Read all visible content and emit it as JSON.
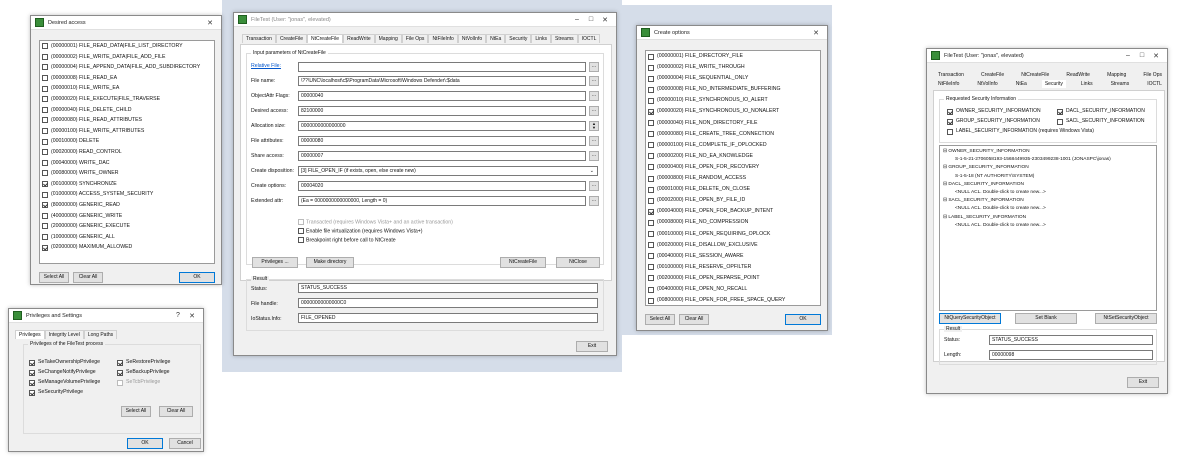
{
  "desired_access": {
    "title": "Desired access",
    "items": [
      {
        "label": "(00000001) FILE_READ_DATA|FILE_LIST_DIRECTORY",
        "checked": false
      },
      {
        "label": "(00000002) FILE_WRITE_DATA|FILE_ADD_FILE",
        "checked": false
      },
      {
        "label": "(00000004) FILE_APPEND_DATA|FILE_ADD_SUBDIRECTORY",
        "checked": false
      },
      {
        "label": "(00000008) FILE_READ_EA",
        "checked": false
      },
      {
        "label": "(00000010) FILE_WRITE_EA",
        "checked": false
      },
      {
        "label": "(00000020) FILE_EXECUTE|FILE_TRAVERSE",
        "checked": false
      },
      {
        "label": "(00000040) FILE_DELETE_CHILD",
        "checked": false
      },
      {
        "label": "(00000080) FILE_READ_ATTRIBUTES",
        "checked": false
      },
      {
        "label": "(00000100) FILE_WRITE_ATTRIBUTES",
        "checked": false
      },
      {
        "label": "(00010000) DELETE",
        "checked": false
      },
      {
        "label": "(00020000) READ_CONTROL",
        "checked": false
      },
      {
        "label": "(00040000) WRITE_DAC",
        "checked": false
      },
      {
        "label": "(00080000) WRITE_OWNER",
        "checked": false
      },
      {
        "label": "(00100000) SYNCHRONIZE",
        "checked": true
      },
      {
        "label": "(01000000) ACCESS_SYSTEM_SECURITY",
        "checked": false
      },
      {
        "label": "(80000000) GENERIC_READ",
        "checked": true
      },
      {
        "label": "(40000000) GENERIC_WRITE",
        "checked": false
      },
      {
        "label": "(20000000) GENERIC_EXECUTE",
        "checked": false
      },
      {
        "label": "(10000000) GENERIC_ALL",
        "checked": false
      },
      {
        "label": "(02000000) MAXIMUM_ALLOWED",
        "checked": true
      }
    ],
    "select_all": "Select All",
    "clear_all": "Clear All",
    "ok": "OK"
  },
  "privileges": {
    "title": "Privileges and Settings",
    "help": "?",
    "close": "✕",
    "tabs": [
      "Privileges",
      "Integrity Level",
      "Long Paths"
    ],
    "group_title": "Privileges of the FileTest process",
    "items": [
      {
        "label": "SeTakeOwnershipPrivilege",
        "checked": true,
        "enabled": true
      },
      {
        "label": "SeRestorePrivilege",
        "checked": true,
        "enabled": true
      },
      {
        "label": "SeChangeNotifyPrivilege",
        "checked": true,
        "enabled": true
      },
      {
        "label": "SeBackupPrivilege",
        "checked": true,
        "enabled": true
      },
      {
        "label": "SeManageVolumePrivilege",
        "checked": true,
        "enabled": true
      },
      {
        "label": "SeTcbPrivilege",
        "checked": false,
        "enabled": false
      },
      {
        "label": "SeSecurityPrivilege",
        "checked": true,
        "enabled": true
      }
    ],
    "select_all": "Select All",
    "clear_all": "Clear All",
    "ok": "OK",
    "cancel": "Cancel"
  },
  "filetest_main": {
    "title": "FileTest (User: \"jonas\", elevated)",
    "tabs": [
      "Transaction",
      "CreateFile",
      "NtCreateFile",
      "ReadWrite",
      "Mapping",
      "File Ops",
      "NtFileInfo",
      "NtVolInfo",
      "NtEa",
      "Security",
      "Links",
      "Streams",
      "IOCTL"
    ],
    "active_tab": 2,
    "group_title": "Input parameters of NtCreateFile",
    "relative_file_label": "Relative File:",
    "file_name_label": "File name:",
    "file_name_value": "\\??\\UNC\\localhost\\c$\\ProgramData\\Microsoft\\Windows Defender\\:$data",
    "object_attr_label": "ObjectAttr Flags:",
    "object_attr_value": "00000040",
    "desired_access_label": "Desired access:",
    "desired_access_value": "82100000",
    "allocation_label": "Allocation size:",
    "allocation_value": "0000000000000000",
    "file_attr_label": "File attributes:",
    "file_attr_value": "00000080",
    "share_access_label": "Share access:",
    "share_access_value": "00000007",
    "create_disp_label": "Create disposition:",
    "create_disp_value": "[3] FILE_OPEN_IF (if exists, open, else create new)",
    "create_options_label": "Create options:",
    "create_options_value": "00004020",
    "extended_attr_label": "Extended attr:",
    "extended_attr_value": "(Ea = 0000000000000000, Length = 0)",
    "chk_transacted": "Transacted (requires Windows Vista+ and an active transaction)",
    "chk_virtualization": "Enable file virtualization (requires Windows Vista+)",
    "chk_breakpoint": "Breakpoint right before call to NtCreate",
    "privileges_btn": "Privileges ...",
    "make_directory_btn": "Make directory",
    "ntcreatefile_btn": "NtCreateFile",
    "ntclose_btn": "NtClose",
    "result_title": "Result",
    "status_label": "Status:",
    "status_value": "STATUS_SUCCESS",
    "file_handle_label": "File handle:",
    "file_handle_value": "00000000000000C0",
    "iostatus_label": "IoStatus.Info:",
    "iostatus_value": "FILE_OPENED",
    "exit_btn": "Exit",
    "browse": "..."
  },
  "create_options": {
    "title": "Create options",
    "items": [
      {
        "label": "(00000001) FILE_DIRECTORY_FILE",
        "checked": false
      },
      {
        "label": "(00000002) FILE_WRITE_THROUGH",
        "checked": false
      },
      {
        "label": "(00000004) FILE_SEQUENTIAL_ONLY",
        "checked": false
      },
      {
        "label": "(00000008) FILE_NO_INTERMEDIATE_BUFFERING",
        "checked": false
      },
      {
        "label": "(00000010) FILE_SYNCHRONOUS_IO_ALERT",
        "checked": false
      },
      {
        "label": "(00000020) FILE_SYNCHRONOUS_IO_NONALERT",
        "checked": true
      },
      {
        "label": "(00000040) FILE_NON_DIRECTORY_FILE",
        "checked": false
      },
      {
        "label": "(00000080) FILE_CREATE_TREE_CONNECTION",
        "checked": false
      },
      {
        "label": "(00000100) FILE_COMPLETE_IF_OPLOCKED",
        "checked": false
      },
      {
        "label": "(00000200) FILE_NO_EA_KNOWLEDGE",
        "checked": false
      },
      {
        "label": "(00000400) FILE_OPEN_FOR_RECOVERY",
        "checked": false
      },
      {
        "label": "(00000800) FILE_RANDOM_ACCESS",
        "checked": false
      },
      {
        "label": "(00001000) FILE_DELETE_ON_CLOSE",
        "checked": false
      },
      {
        "label": "(00002000) FILE_OPEN_BY_FILE_ID",
        "checked": false
      },
      {
        "label": "(00004000) FILE_OPEN_FOR_BACKUP_INTENT",
        "checked": true
      },
      {
        "label": "(00008000) FILE_NO_COMPRESSION",
        "checked": false
      },
      {
        "label": "(00010000) FILE_OPEN_REQUIRING_OPLOCK",
        "checked": false
      },
      {
        "label": "(00020000) FILE_DISALLOW_EXCLUSIVE",
        "checked": false
      },
      {
        "label": "(00040000) FILE_SESSION_AWARE",
        "checked": false
      },
      {
        "label": "(00100000) FILE_RESERVE_OPFILTER",
        "checked": false
      },
      {
        "label": "(00200000) FILE_OPEN_REPARSE_POINT",
        "checked": false
      },
      {
        "label": "(00400000) FILE_OPEN_NO_RECALL",
        "checked": false
      },
      {
        "label": "(00800000) FILE_OPEN_FOR_FREE_SPACE_QUERY",
        "checked": false
      }
    ],
    "select_all": "Select All",
    "clear_all": "Clear All",
    "ok": "OK"
  },
  "filetest_security": {
    "title": "FileTest (User: \"jonas\", elevated)",
    "tabs_row1": [
      "Transaction",
      "CreateFile",
      "NtCreateFile",
      "ReadWrite",
      "Mapping",
      "File Ops"
    ],
    "tabs_row2": [
      "NtFileInfo",
      "NtVolInfo",
      "NtEa",
      "Security",
      "Links",
      "Streams",
      "IOCTL"
    ],
    "group_title": "Requested Security Information",
    "checks": [
      {
        "label": "OWNER_SECURITY_INFORMATION",
        "checked": true
      },
      {
        "label": "DACL_SECURITY_INFORMATION",
        "checked": true
      },
      {
        "label": "GROUP_SECURITY_INFORMATION",
        "checked": true
      },
      {
        "label": "SACL_SECURITY_INFORMATION",
        "checked": false
      },
      {
        "label": "LABEL_SECURITY_INFORMATION (requires Windows Vista)",
        "checked": false
      }
    ],
    "tree": [
      {
        "text": "⊟ OWNER_SECURITY_INFORMATION",
        "indent": 0
      },
      {
        "text": "S-1-5-21-2706058193-1568449935-2303499238-1001 (JONASPC\\jonas)",
        "indent": 2
      },
      {
        "text": "⊟ GROUP_SECURITY_INFORMATION",
        "indent": 0
      },
      {
        "text": "S-1-5-18 (NT AUTHORITY\\SYSTEM)",
        "indent": 2
      },
      {
        "text": "⊟ DACL_SECURITY_INFORMATION",
        "indent": 0
      },
      {
        "text": "<NULL ACL. Double-click to create new...>",
        "indent": 2
      },
      {
        "text": "⊟ SACL_SECURITY_INFORMATION",
        "indent": 0
      },
      {
        "text": "<NULL ACL. Double-click to create new...>",
        "indent": 2
      },
      {
        "text": "⊟ LABEL_SECURITY_INFORMATION",
        "indent": 0
      },
      {
        "text": "<NULL ACL. Double-click to create new...>",
        "indent": 2
      }
    ],
    "query_btn": "NtQuerySecurityObject",
    "set_blank_btn": "Set Blank",
    "set_btn": "NtSetSecurityObject",
    "result_title": "Result",
    "status_label": "Status:",
    "status_value": "STATUS_SUCCESS",
    "length_label": "Length:",
    "length_value": "00000098",
    "exit_btn": "Exit"
  },
  "colors": {
    "background_panel": "#d5dde9",
    "accent": "#0078d7"
  }
}
